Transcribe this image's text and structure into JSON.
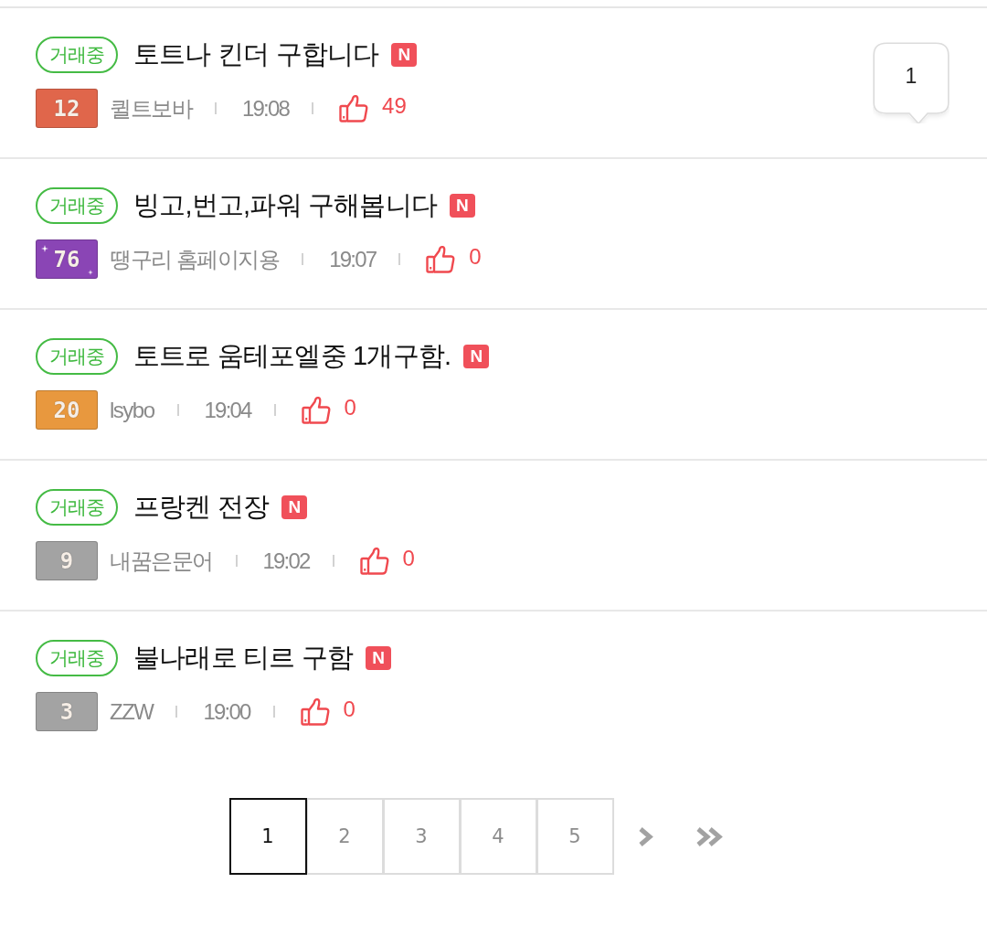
{
  "posts": [
    {
      "status": "거래중",
      "title": "토트나 킨더 구합니다",
      "new_tag": "N",
      "badge": {
        "text": "12",
        "color": "#e0664b",
        "sparkles": false
      },
      "author": "퀼트보바",
      "time": "19:08",
      "likes": "49",
      "comments": "1"
    },
    {
      "status": "거래중",
      "title": "빙고,번고,파워 구해봅니다",
      "new_tag": "N",
      "badge": {
        "text": "76",
        "color": "#8a45b5",
        "sparkles": true
      },
      "author": "땡구리 홈페이지용",
      "time": "19:07",
      "likes": "0"
    },
    {
      "status": "거래중",
      "title": "토트로 움테포엘중 1개구함.",
      "new_tag": "N",
      "badge": {
        "text": "20",
        "color": "#e8983e",
        "sparkles": false
      },
      "author": "lsybo",
      "time": "19:04",
      "likes": "0"
    },
    {
      "status": "거래중",
      "title": "프랑켄 전장",
      "new_tag": "N",
      "badge": {
        "text": "9",
        "color": "#a3a3a3",
        "sparkles": false
      },
      "author": "내꿈은문어",
      "time": "19:02",
      "likes": "0"
    },
    {
      "status": "거래중",
      "title": "불나래로 티르 구함",
      "new_tag": "N",
      "badge": {
        "text": "3",
        "color": "#a3a3a3",
        "sparkles": false
      },
      "author": "ZZW",
      "time": "19:00",
      "likes": "0"
    }
  ],
  "pagination": {
    "pages": [
      {
        "label": "1",
        "selected": true
      },
      {
        "label": "2",
        "selected": false
      },
      {
        "label": "3",
        "selected": false
      },
      {
        "label": "4",
        "selected": false
      },
      {
        "label": "5",
        "selected": false
      }
    ]
  }
}
